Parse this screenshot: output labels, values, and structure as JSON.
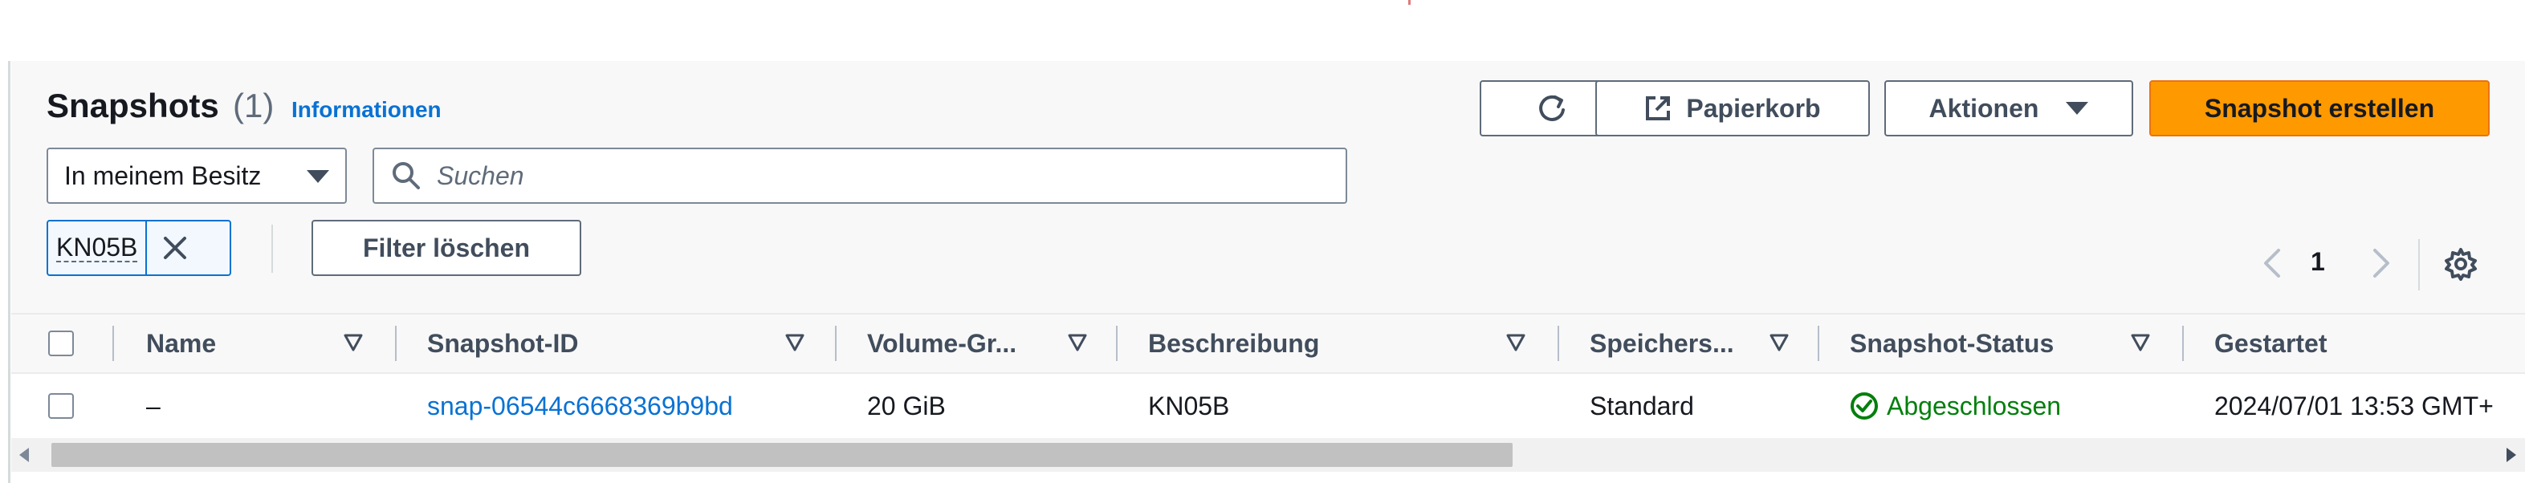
{
  "header": {
    "title": "Snapshots",
    "count": "(1)",
    "info_link": "Informationen"
  },
  "toolbar": {
    "refresh_icon": "refresh-icon",
    "trash_label": "Papierkorb",
    "trash_icon": "external-link-icon",
    "actions_label": "Aktionen",
    "create_label": "Snapshot erstellen"
  },
  "filter": {
    "ownership_value": "In meinem Besitz",
    "search_placeholder": "Suchen",
    "token_label": "KN05B",
    "clear_label": "Filter löschen"
  },
  "pagination": {
    "current_page": "1"
  },
  "table": {
    "columns": [
      {
        "label": "Name"
      },
      {
        "label": "Snapshot-ID"
      },
      {
        "label": "Volume-Gr..."
      },
      {
        "label": "Beschreibung"
      },
      {
        "label": "Speichers..."
      },
      {
        "label": "Snapshot-Status"
      },
      {
        "label": "Gestartet"
      }
    ],
    "rows": [
      {
        "name": "–",
        "snapshot_id": "snap-06544c6668369b9bd",
        "volume_size": "20 GiB",
        "description": "KN05B",
        "storage": "Standard",
        "status": "Abgeschlossen",
        "started": "2024/07/01 13:53 GMT+"
      }
    ]
  },
  "colors": {
    "accent": "#0972d3",
    "primary_button": "#ff9900",
    "success": "#037f0c"
  }
}
